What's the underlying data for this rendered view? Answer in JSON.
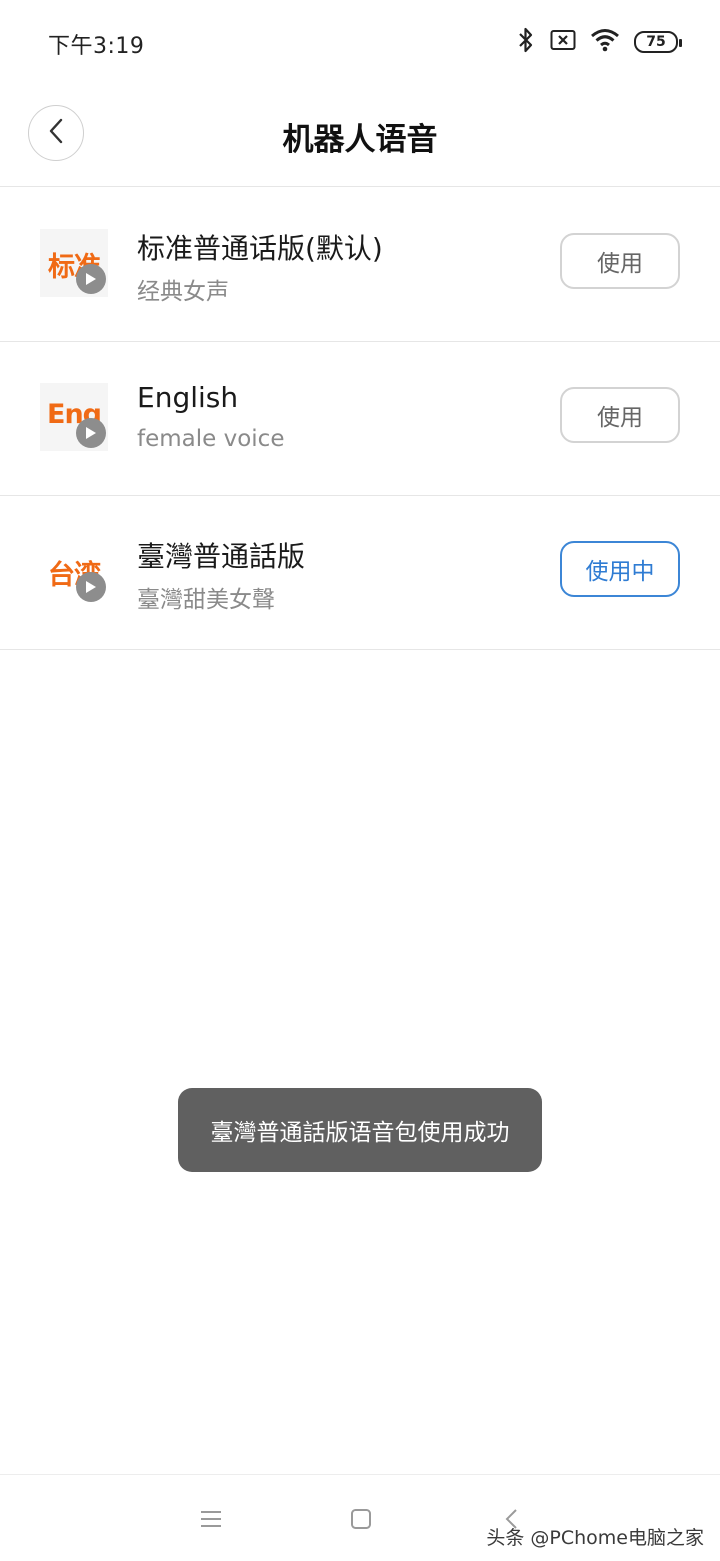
{
  "status_bar": {
    "time": "下午3:19",
    "icons": [
      "bluetooth-icon",
      "sim-x-icon",
      "wifi-icon",
      "battery-icon"
    ],
    "battery_level": "75"
  },
  "header": {
    "back_icon": "chevron-left-icon",
    "title": "机器人语音"
  },
  "voices": [
    {
      "thumb_label": "标准",
      "title": "标准普通话版(默认)",
      "subtitle": "经典女声",
      "button": "使用",
      "active": false
    },
    {
      "thumb_label": "Eng",
      "title": "English",
      "subtitle": "female voice",
      "button": "使用",
      "active": false
    },
    {
      "thumb_label": "台湾",
      "title": "臺灣普通話版",
      "subtitle": "臺灣甜美女聲",
      "button": "使用中",
      "active": true
    }
  ],
  "toast": {
    "message": "臺灣普通話版语音包使用成功"
  },
  "bottom_nav": {
    "icons": [
      "menu-icon",
      "home-square-icon",
      "back-chevron-icon"
    ],
    "watermark": "头条 @PChome电脑之家"
  },
  "colors": {
    "accent": "#2f7cd3",
    "thumb_text": "#f06a15",
    "toast_bg": "#606060"
  }
}
